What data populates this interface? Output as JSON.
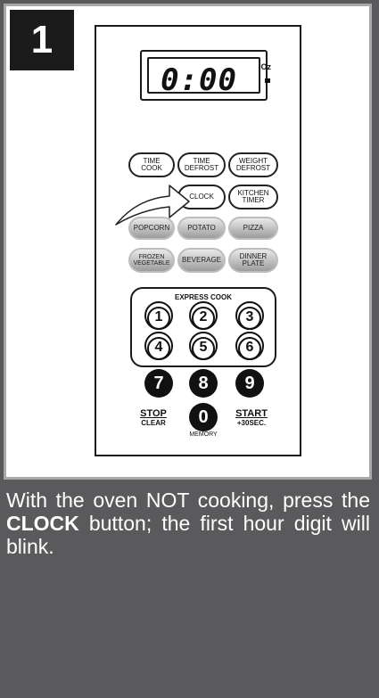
{
  "step": {
    "number": "1"
  },
  "display": {
    "time": "0:00",
    "unit_label": "Oz"
  },
  "buttons": {
    "time_cook": [
      "TIME",
      "COOK"
    ],
    "time_defrost": [
      "TIME",
      "DEFROST"
    ],
    "weight_defrost": [
      "WEIGHT",
      "DEFROST"
    ],
    "clock": "CLOCK",
    "kitchen_timer": [
      "KITCHEN",
      "TIMER"
    ],
    "popcorn": "POPCORN",
    "potato": "POTATO",
    "pizza": "PIZZA",
    "frozen_vegetable": [
      "FROZEN",
      "VEGETABLE"
    ],
    "beverage": "BEVERAGE",
    "dinner_plate": [
      "DINNER",
      "PLATE"
    ]
  },
  "express": {
    "label": "EXPRESS COOK"
  },
  "numbers": {
    "n1": "1",
    "n2": "2",
    "n3": "3",
    "n4": "4",
    "n5": "5",
    "n6": "6",
    "n7": "7",
    "n8": "8",
    "n9": "9",
    "n0": "0"
  },
  "stop": {
    "top": "STOP",
    "bottom": "CLEAR"
  },
  "start": {
    "top": "START",
    "bottom": "+30SEC."
  },
  "memory_label": "MEMORY",
  "caption": {
    "before": "With the oven NOT cooking, press the ",
    "bold": "CLOCK",
    "after": " button; the first hour digit will blink."
  },
  "colors": {
    "badge": "#1b1b1b",
    "background_dark": "#5a5a5c",
    "caption_text": "#ffffff"
  }
}
